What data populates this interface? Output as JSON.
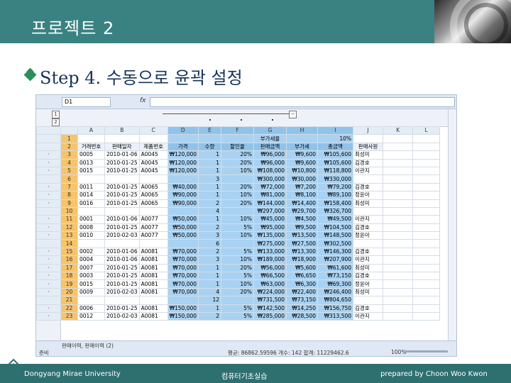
{
  "slide": {
    "title": "프로젝트 2",
    "subtitle": "Step 4. 수동으로 윤곽 설정",
    "footer_left": "Dongyang Mirae University",
    "footer_center": "컴퓨터기초실습",
    "footer_right": "prepared by Choon Woo Kwon"
  },
  "excel": {
    "name_box": "D1",
    "fx_label": "fx",
    "outline_levels": [
      "1",
      "2"
    ],
    "columns": [
      "A",
      "B",
      "C",
      "D",
      "E",
      "F",
      "G",
      "H",
      "I",
      "J",
      "K",
      "L"
    ],
    "row1": {
      "label": "부가세율",
      "value": "10%"
    },
    "headers": [
      "거래번호",
      "판매일자",
      "제품번호",
      "가격",
      "수량",
      "할인율",
      "판매금액",
      "부가세",
      "총금액",
      "판매사원"
    ],
    "rows": [
      [
        "3",
        "0005",
        "2010-01-06",
        "A0045",
        "₩120,000",
        "1",
        "20%",
        "₩96,000",
        "₩9,600",
        "₩105,600",
        "최성미"
      ],
      [
        "4",
        "0013",
        "2010-01-25",
        "A0045",
        "₩120,000",
        "1",
        "20%",
        "₩96,000",
        "₩9,600",
        "₩105,600",
        "김경호"
      ],
      [
        "5",
        "0015",
        "2010-01-25",
        "A0045",
        "₩120,000",
        "1",
        "10%",
        "₩108,000",
        "₩10,800",
        "₩118,800",
        "이관지"
      ],
      [
        "6",
        "",
        "",
        "",
        "",
        "3",
        "",
        "₩300,000",
        "₩30,000",
        "₩330,000",
        ""
      ],
      [
        "7",
        "0011",
        "2010-01-25",
        "A0065",
        "₩40,000",
        "1",
        "20%",
        "₩72,000",
        "₩7,200",
        "₩79,200",
        "김경호"
      ],
      [
        "8",
        "0014",
        "2010-01-25",
        "A0065",
        "₩90,000",
        "1",
        "10%",
        "₩81,000",
        "₩8,100",
        "₩89,100",
        "정윤아"
      ],
      [
        "9",
        "0016",
        "2010-01-25",
        "A0065",
        "₩90,000",
        "2",
        "20%",
        "₩144,000",
        "₩14,400",
        "₩158,400",
        "최성미"
      ],
      [
        "10",
        "",
        "",
        "",
        "",
        "4",
        "",
        "₩297,000",
        "₩29,700",
        "₩326,700",
        ""
      ],
      [
        "11",
        "0001",
        "2010-01-06",
        "A0077",
        "₩50,000",
        "1",
        "10%",
        "₩45,000",
        "₩4,500",
        "₩49,500",
        "이관지"
      ],
      [
        "12",
        "0008",
        "2010-01-25",
        "A0077",
        "₩50,000",
        "2",
        "5%",
        "₩95,000",
        "₩9,500",
        "₩104,500",
        "김경호"
      ],
      [
        "13",
        "0010",
        "2010-02-03",
        "A0077",
        "₩50,000",
        "3",
        "10%",
        "₩135,000",
        "₩13,500",
        "₩148,500",
        "정윤아"
      ],
      [
        "14",
        "",
        "",
        "",
        "",
        "6",
        "",
        "₩275,000",
        "₩27,500",
        "₩302,500",
        ""
      ],
      [
        "15",
        "0002",
        "2010-01-06",
        "A0081",
        "₩70,000",
        "2",
        "5%",
        "₩133,000",
        "₩13,300",
        "₩146,300",
        "김경호"
      ],
      [
        "16",
        "0004",
        "2010-01-06",
        "A0081",
        "₩70,000",
        "3",
        "10%",
        "₩189,000",
        "₩18,900",
        "₩207,900",
        "이관지"
      ],
      [
        "17",
        "0007",
        "2010-01-25",
        "A0081",
        "₩70,000",
        "1",
        "20%",
        "₩56,000",
        "₩5,600",
        "₩61,600",
        "최성미"
      ],
      [
        "18",
        "0003",
        "2010-01-25",
        "A0081",
        "₩70,000",
        "1",
        "5%",
        "₩66,500",
        "₩6,650",
        "₩73,150",
        "김경호"
      ],
      [
        "19",
        "0015",
        "2010-01-25",
        "A0081",
        "₩70,000",
        "1",
        "10%",
        "₩63,000",
        "₩6,300",
        "₩69,300",
        "정윤아"
      ],
      [
        "20",
        "0009",
        "2010-02-03",
        "A0081",
        "₩70,000",
        "4",
        "20%",
        "₩224,000",
        "₩22,400",
        "₩246,400",
        "최성미"
      ],
      [
        "21",
        "",
        "",
        "",
        "",
        "12",
        "",
        "₩731,500",
        "₩73,150",
        "₩804,650",
        ""
      ],
      [
        "22",
        "0006",
        "2010-01-25",
        "A0081",
        "₩150,000",
        "1",
        "5%",
        "₩142,500",
        "₩14,250",
        "₩156,750",
        "김경호"
      ],
      [
        "23",
        "0012",
        "2010-02-03",
        "A0081",
        "₩150,000",
        "2",
        "5%",
        "₩285,000",
        "₩28,500",
        "₩313,500",
        "이관지"
      ]
    ],
    "status_ready": "준비",
    "sheet_tabs": "판매이력, 판매이력 (2)",
    "status_summary": "평균: 86862.59596   개수: 142   합계: 11229462.6",
    "zoom": "100%"
  },
  "colors": {
    "header_bg": "#3a8282",
    "footer_bg": "#2e7070",
    "selection": "#a9d2f2",
    "row_header_selected": "#f6c46a"
  }
}
